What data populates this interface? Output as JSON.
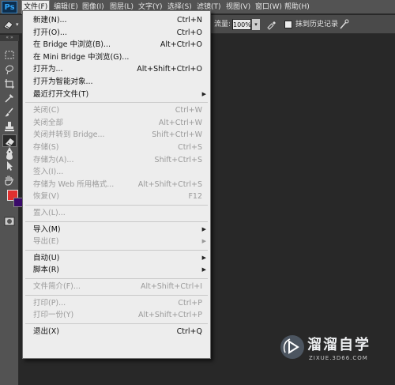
{
  "app": {
    "logo": "Ps"
  },
  "menubar": {
    "items": [
      {
        "label": "文件(F)",
        "active": true
      },
      {
        "label": "编辑(E)"
      },
      {
        "label": "图像(I)"
      },
      {
        "label": "图层(L)"
      },
      {
        "label": "文字(Y)"
      },
      {
        "label": "选择(S)"
      },
      {
        "label": "滤镜(T)"
      },
      {
        "label": "视图(V)"
      },
      {
        "label": "窗口(W)"
      },
      {
        "label": "帮助(H)"
      }
    ]
  },
  "optionsbar": {
    "flow_label": "流量:",
    "flow_value": "100%",
    "history_label": "抹到历史记录",
    "history_checked": false
  },
  "toolbar": {
    "header": "« »",
    "tools": [
      "marquee-tool-icon",
      "lasso-tool-icon",
      "crop-tool-icon",
      "eyedropper-tool-icon",
      "brush-tool-icon",
      "stamp-tool-icon",
      "eraser-tool-icon",
      "blur-tool-icon",
      "pen-tool-icon",
      "path-select-tool-icon",
      "hand-tool-icon"
    ],
    "foreground_color": "#e03030",
    "background_color": "#3a0a6a"
  },
  "file_menu": {
    "items": [
      {
        "label": "新建(N)...",
        "shortcut": "Ctrl+N",
        "enabled": true
      },
      {
        "label": "打开(O)...",
        "shortcut": "Ctrl+O",
        "enabled": true
      },
      {
        "label": "在 Bridge 中浏览(B)...",
        "shortcut": "Alt+Ctrl+O",
        "enabled": true
      },
      {
        "label": "在 Mini Bridge 中浏览(G)...",
        "shortcut": "",
        "enabled": true
      },
      {
        "label": "打开为...",
        "shortcut": "Alt+Shift+Ctrl+O",
        "enabled": true
      },
      {
        "label": "打开为智能对象...",
        "shortcut": "",
        "enabled": true
      },
      {
        "label": "最近打开文件(T)",
        "shortcut": "",
        "enabled": true,
        "submenu": true
      },
      {
        "separator": true
      },
      {
        "label": "关闭(C)",
        "shortcut": "Ctrl+W",
        "enabled": false
      },
      {
        "label": "关闭全部",
        "shortcut": "Alt+Ctrl+W",
        "enabled": false
      },
      {
        "label": "关闭并转到 Bridge...",
        "shortcut": "Shift+Ctrl+W",
        "enabled": false
      },
      {
        "label": "存储(S)",
        "shortcut": "Ctrl+S",
        "enabled": false
      },
      {
        "label": "存储为(A)...",
        "shortcut": "Shift+Ctrl+S",
        "enabled": false
      },
      {
        "label": "签入(I)...",
        "shortcut": "",
        "enabled": false
      },
      {
        "label": "存储为 Web 所用格式...",
        "shortcut": "Alt+Shift+Ctrl+S",
        "enabled": false
      },
      {
        "label": "恢复(V)",
        "shortcut": "F12",
        "enabled": false
      },
      {
        "separator": true
      },
      {
        "label": "置入(L)...",
        "shortcut": "",
        "enabled": false
      },
      {
        "separator": true
      },
      {
        "label": "导入(M)",
        "shortcut": "",
        "enabled": true,
        "submenu": true
      },
      {
        "label": "导出(E)",
        "shortcut": "",
        "enabled": false,
        "submenu": true
      },
      {
        "separator": true
      },
      {
        "label": "自动(U)",
        "shortcut": "",
        "enabled": true,
        "submenu": true
      },
      {
        "label": "脚本(R)",
        "shortcut": "",
        "enabled": true,
        "submenu": true
      },
      {
        "separator": true
      },
      {
        "label": "文件简介(F)...",
        "shortcut": "Alt+Shift+Ctrl+I",
        "enabled": false
      },
      {
        "separator": true
      },
      {
        "label": "打印(P)...",
        "shortcut": "Ctrl+P",
        "enabled": false
      },
      {
        "label": "打印一份(Y)",
        "shortcut": "Alt+Shift+Ctrl+P",
        "enabled": false
      },
      {
        "separator": true
      },
      {
        "label": "退出(X)",
        "shortcut": "Ctrl+Q",
        "enabled": true
      }
    ]
  },
  "watermark": {
    "title": "溜溜自学",
    "subtitle": "ZIXUE.3D66.COM"
  }
}
